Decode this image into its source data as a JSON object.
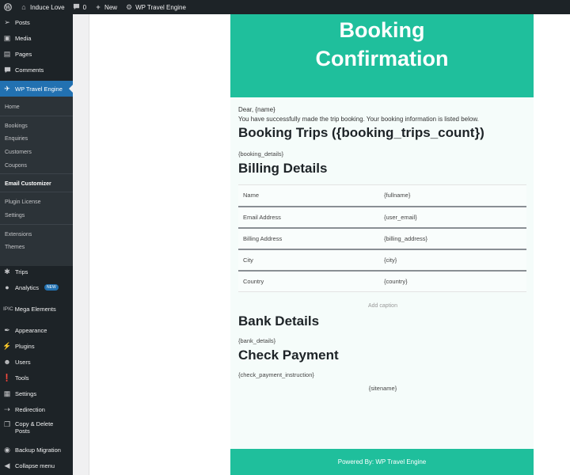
{
  "admin_bar": {
    "site_name": "Induce Love",
    "comments_count": "0",
    "new_label": "New",
    "plugin_label": "WP Travel Engine"
  },
  "sidebar": {
    "top_items": [
      {
        "label": "Posts",
        "icon": "pin-icon"
      },
      {
        "label": "Media",
        "icon": "media-icon"
      },
      {
        "label": "Pages",
        "icon": "pages-icon"
      },
      {
        "label": "Comments",
        "icon": "comment-icon"
      }
    ],
    "active_item": {
      "label": "WP Travel Engine",
      "icon": "plane-icon"
    },
    "submenu": [
      {
        "label": "Home",
        "bold": false
      },
      {
        "label": "Bookings",
        "bold": false
      },
      {
        "label": "Enquiries",
        "bold": false
      },
      {
        "label": "Customers",
        "bold": false
      },
      {
        "label": "Coupons",
        "bold": false
      },
      {
        "label": "Email Customizer",
        "bold": true
      },
      {
        "label": "Plugin License",
        "bold": false
      },
      {
        "label": "Settings",
        "bold": false
      },
      {
        "label": "Extensions",
        "bold": false
      },
      {
        "label": "Themes",
        "bold": false
      }
    ],
    "bottom_items": [
      {
        "label": "Trips",
        "icon": "trips-icon"
      },
      {
        "label": "Analytics",
        "icon": "analytics-icon",
        "badge": "NEW"
      },
      {
        "label": "Mega Elements",
        "icon": "mega-elements-icon",
        "prefix": "IPIC"
      },
      {
        "label": "Appearance",
        "icon": "brush-icon"
      },
      {
        "label": "Plugins",
        "icon": "plugin-icon"
      },
      {
        "label": "Users",
        "icon": "user-icon"
      },
      {
        "label": "Tools",
        "icon": "wrench-icon"
      },
      {
        "label": "Settings",
        "icon": "settings-icon"
      },
      {
        "label": "Redirection",
        "icon": "redirect-icon"
      },
      {
        "label": "Copy & Delete Posts",
        "icon": "copy-icon"
      },
      {
        "label": "Backup Migration",
        "icon": "backup-icon"
      },
      {
        "label": "Collapse menu",
        "icon": "collapse-icon"
      }
    ]
  },
  "email": {
    "header_line1": "Booking",
    "header_line2": "Confirmation",
    "greeting": "Dear, {name}",
    "intro": "You have successfully made the trip booking. Your booking information is listed below.",
    "booking_heading": "Booking Trips ({booking_trips_count})",
    "booking_details": "{booking_details}",
    "billing_heading": "Billing Details",
    "billing_rows": [
      {
        "label": "Name",
        "value": "{fullname}"
      },
      {
        "label": "Email Address",
        "value": "{user_email}"
      },
      {
        "label": "Billing Address",
        "value": "{billing_address}"
      },
      {
        "label": "City",
        "value": "{city}"
      },
      {
        "label": "Country",
        "value": "{country}"
      }
    ],
    "caption": "Add caption",
    "bank_heading": "Bank Details",
    "bank_details": "{bank_details}",
    "check_heading": "Check Payment",
    "check_instruction": "{check_payment_instruction}",
    "sitename": "{sitename}",
    "footer": "Powered By: WP Travel Engine"
  },
  "colors": {
    "accent": "#1fbf9c",
    "admin_dark": "#1d2327",
    "wp_blue": "#2271b1"
  }
}
